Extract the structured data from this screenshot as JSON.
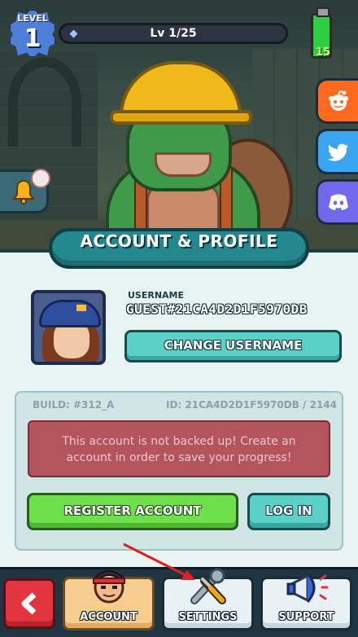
{
  "hud": {
    "level_label": "LEVEL",
    "level_value": "1",
    "xp_text": "Lv 1/25",
    "energy_value": "15"
  },
  "social": {
    "reddit_icon": "reddit-icon",
    "twitter_icon": "twitter-icon",
    "discord_icon": "discord-icon"
  },
  "panel": {
    "title": "ACCOUNT & PROFILE",
    "username_label": "USERNAME",
    "username_value": "GUEST#21CA4D2D1F5970DB",
    "change_username_label": "CHANGE USERNAME",
    "build_text": "BUILD: #312_A",
    "id_text": "ID: 21CA4D2D1F5970DB / 2144",
    "warning_line1": "This account is not backed up! Create an",
    "warning_line2": "account in order to save your progress!",
    "register_label": "REGISTER ACCOUNT",
    "login_label": "LOG IN"
  },
  "nav": {
    "account_label": "ACCOUNT",
    "settings_label": "SETTINGS",
    "support_label": "SUPPORT"
  },
  "colors": {
    "accent_teal": "#24898f",
    "register_green": "#6ee04a",
    "warning_red": "#b4555e",
    "back_red": "#e2353f"
  }
}
